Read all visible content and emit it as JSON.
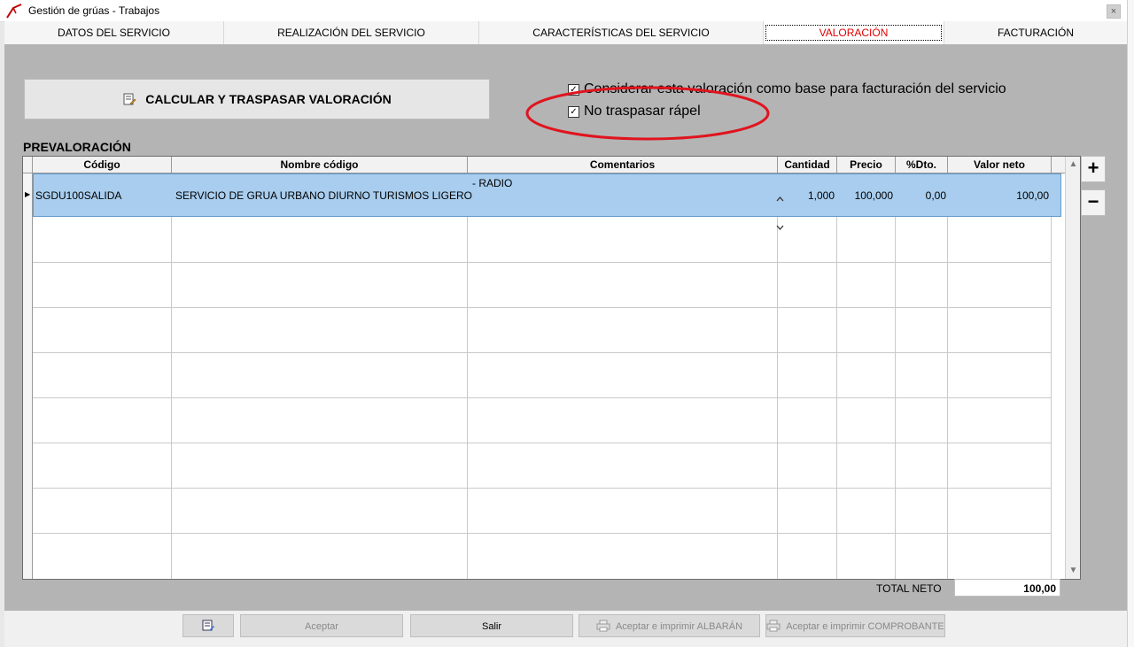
{
  "window": {
    "title": "Gestión de grúas - Trabajos",
    "close": "×"
  },
  "tabs": [
    {
      "label": "DATOS DEL SERVICIO"
    },
    {
      "label": "REALIZACIÓN DEL SERVICIO"
    },
    {
      "label": "CARACTERÍSTICAS DEL SERVICIO"
    },
    {
      "label": "VALORACIÓN",
      "active": true
    },
    {
      "label": "FACTURACIÓN"
    }
  ],
  "actions": {
    "calculate_label": "CALCULAR Y TRASPASAR VALORACIÓN"
  },
  "options": {
    "base_facturacion": {
      "label": "Considerar esta valoración como base para facturación del servicio",
      "checked": true
    },
    "no_rapel": {
      "label": "No traspasar rápel",
      "checked": true
    }
  },
  "prevaloracion": {
    "title": "PREVALORACIÓN",
    "columns": [
      "Código",
      "Nombre código",
      "Comentarios",
      "Cantidad",
      "Precio",
      "%Dto.",
      "Valor neto"
    ],
    "rows": [
      {
        "codigo": "SGDU100SALIDA",
        "nombre": "SERVICIO DE GRUA URBANO DIURNO TURISMOS LIGERO",
        "comentarios": "- RADIO",
        "cantidad": "1,000",
        "precio": "100,000",
        "dto": "0,00",
        "valor_neto": "100,00"
      }
    ],
    "add_label": "+",
    "remove_label": "−"
  },
  "totals": {
    "label": "TOTAL NETO",
    "value": "100,00"
  },
  "footer": {
    "aceptar": "Aceptar",
    "salir": "Salir",
    "aceptar_albaran": "Aceptar e imprimir ALBARÁN",
    "aceptar_comprobante": "Aceptar e imprimir COMPROBANTE"
  },
  "colors": {
    "active_tab": "#e00000",
    "selected_row": "#a8cdee",
    "annotation": "#e0141e"
  }
}
